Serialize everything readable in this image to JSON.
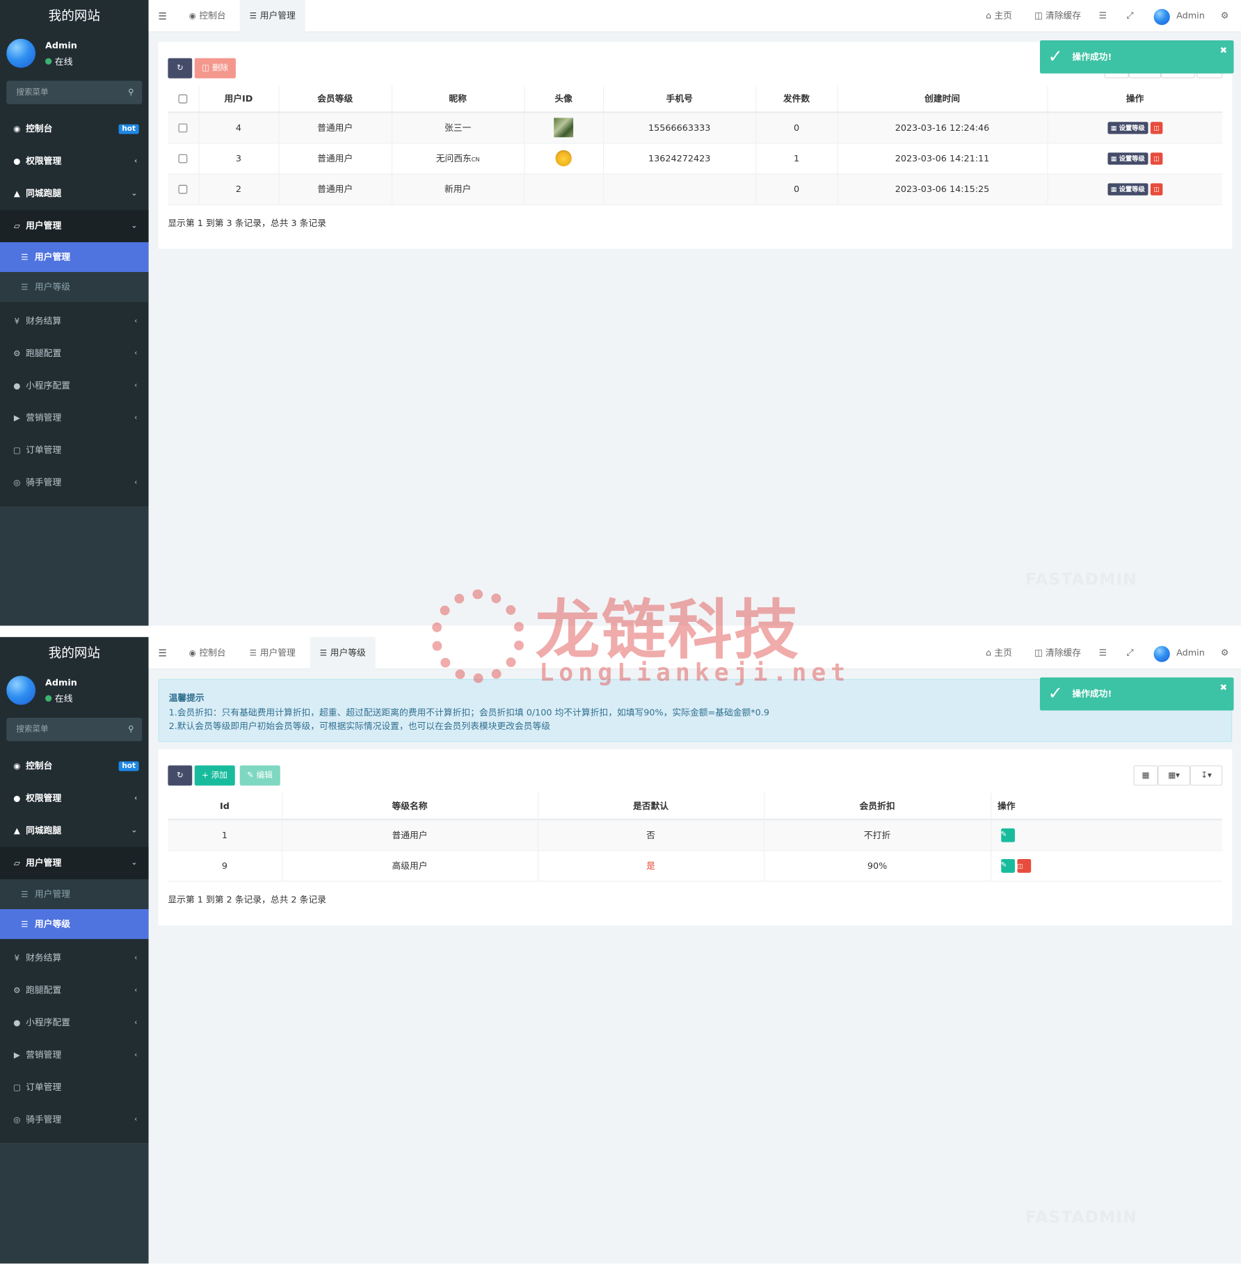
{
  "site_title": "我的网站",
  "user": {
    "name": "Admin",
    "status": "在线"
  },
  "search_placeholder": "搜索菜单",
  "menu": {
    "dashboard": "控制台",
    "hot": "hot",
    "auth": "权限管理",
    "city_run": "同城跑腿",
    "user_mgmt": "用户管理",
    "sub_user_mgmt": "用户管理",
    "sub_user_level": "用户等级",
    "finance": "财务结算",
    "run_config": "跑腿配置",
    "miniapp": "小程序配置",
    "marketing": "营销管理",
    "orders": "订单管理",
    "riders": "骑手管理"
  },
  "topbar": {
    "tab_dashboard": "控制台",
    "tab_user_mgmt": "用户管理",
    "tab_user_level": "用户等级",
    "home": "主页",
    "clear_cache": "清除缓存",
    "admin": "Admin"
  },
  "toast": "操作成功!",
  "panel1": {
    "delete_btn": "删除",
    "columns": [
      "用户ID",
      "会员等级",
      "昵称",
      "头像",
      "手机号",
      "发件数",
      "创建时间",
      "操作"
    ],
    "rows": [
      {
        "id": "4",
        "level": "普通用户",
        "nick": "张三一",
        "phone": "15566663333",
        "count": "0",
        "time": "2023-03-16 12:24:46"
      },
      {
        "id": "3",
        "level": "普通用户",
        "nick": "无问西东",
        "nick_suffix": "CN",
        "phone": "13624272423",
        "count": "1",
        "time": "2023-03-06 14:21:11"
      },
      {
        "id": "2",
        "level": "普通用户",
        "nick": "新用户",
        "phone": "",
        "count": "0",
        "time": "2023-03-06 14:15:25"
      }
    ],
    "set_level": "设置等级",
    "pagination": "显示第 1 到第 3 条记录，总共 3 条记录"
  },
  "panel2": {
    "tip_title": "温馨提示",
    "tip_line1": "1.会员折扣：只有基础费用计算折扣，超重、超过配送距离的费用不计算折扣；会员折扣填 0/100 均不计算折扣，如填写90%，实际金额=基础金额*0.9",
    "tip_line2": "2.默认会员等级即用户初始会员等级，可根据实际情况设置，也可以在会员列表模块更改会员等级",
    "add_btn": "添加",
    "edit_btn": "编辑",
    "columns": [
      "Id",
      "等级名称",
      "是否默认",
      "会员折扣",
      "操作"
    ],
    "rows": [
      {
        "id": "1",
        "name": "普通用户",
        "default": "否",
        "discount": "不打折"
      },
      {
        "id": "9",
        "name": "高级用户",
        "default": "是",
        "discount": "90%"
      }
    ],
    "pagination": "显示第 1 到第 2 条记录，总共 2 条记录"
  },
  "watermark": {
    "cn": "龙链科技",
    "en": "LongLiankeji.net",
    "brand": "FASTADMIN"
  },
  "colors": {
    "sidebar": "#222d32",
    "active": "#4f74e0",
    "success": "#18bc9c",
    "danger": "#e74c3c",
    "toast": "#3cc2a4"
  }
}
